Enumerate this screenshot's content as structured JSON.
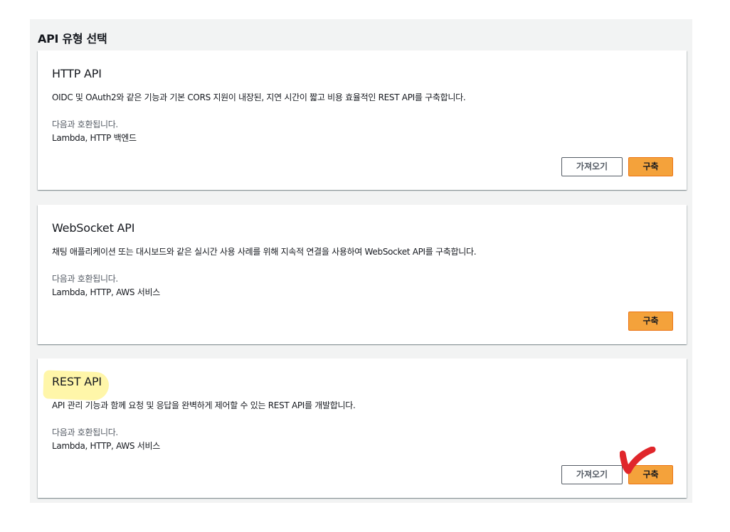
{
  "section": {
    "title": "API 유형 선택"
  },
  "cards": [
    {
      "title": "HTTP API",
      "description": "OIDC 및 OAuth2와 같은 기능과 기본 CORS 지원이 내장된, 지연 시간이 짧고 비용 효율적인 REST API를 구축합니다.",
      "compat_label": "다음과 호환됩니다.",
      "compat_value": "Lambda, HTTP 백엔드",
      "import_label": "가져오기",
      "build_label": "구축"
    },
    {
      "title": "WebSocket API",
      "description": "채팅 애플리케이션 또는 대시보드와 같은 실시간 사용 사례를 위해 지속적 연결을 사용하여 WebSocket API를 구축합니다.",
      "compat_label": "다음과 호환됩니다.",
      "compat_value": "Lambda, HTTP, AWS 서비스",
      "build_label": "구축"
    },
    {
      "title": "REST API",
      "description": "API 관리 기능과 함께 요청 및 응답을 완벽하게 제어할 수 있는 REST API를 개발합니다.",
      "compat_label": "다음과 호환됩니다.",
      "compat_value": "Lambda, HTTP, AWS 서비스",
      "import_label": "가져오기",
      "build_label": "구축"
    }
  ],
  "colors": {
    "primary_button": "#f4a23b",
    "panel_background": "#f2f3f3",
    "highlight": "#fff59a",
    "check_mark": "#e0262b"
  }
}
